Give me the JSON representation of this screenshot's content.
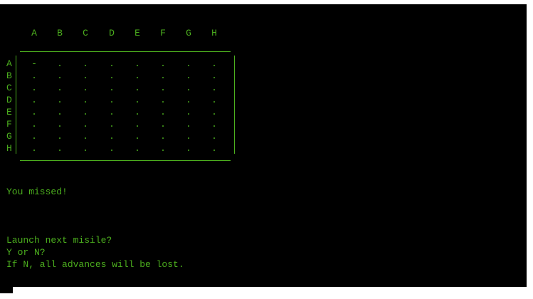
{
  "board": {
    "columns": [
      "A",
      "B",
      "C",
      "D",
      "E",
      "F",
      "G",
      "H"
    ],
    "rows": [
      {
        "label": "A",
        "cells": [
          "-",
          ".",
          ".",
          ".",
          ".",
          ".",
          ".",
          "."
        ]
      },
      {
        "label": "B",
        "cells": [
          ".",
          ".",
          ".",
          ".",
          ".",
          ".",
          ".",
          "."
        ]
      },
      {
        "label": "C",
        "cells": [
          ".",
          ".",
          ".",
          ".",
          ".",
          ".",
          ".",
          "."
        ]
      },
      {
        "label": "D",
        "cells": [
          ".",
          ".",
          ".",
          ".",
          ".",
          ".",
          ".",
          "."
        ]
      },
      {
        "label": "E",
        "cells": [
          ".",
          ".",
          ".",
          ".",
          ".",
          ".",
          ".",
          "."
        ]
      },
      {
        "label": "F",
        "cells": [
          ".",
          ".",
          ".",
          ".",
          ".",
          ".",
          ".",
          "."
        ]
      },
      {
        "label": "G",
        "cells": [
          ".",
          ".",
          ".",
          ".",
          ".",
          ".",
          ".",
          "."
        ]
      },
      {
        "label": "H",
        "cells": [
          ".",
          ".",
          ".",
          ".",
          ".",
          ".",
          ".",
          "."
        ]
      }
    ]
  },
  "messages": {
    "result": "You missed!",
    "prompt_line1": "Launch next misile?",
    "prompt_line2": "Y or N?",
    "prompt_line3": "If N, all advances will be lost."
  },
  "colors": {
    "text": "#4caf1e",
    "background": "#000000"
  }
}
